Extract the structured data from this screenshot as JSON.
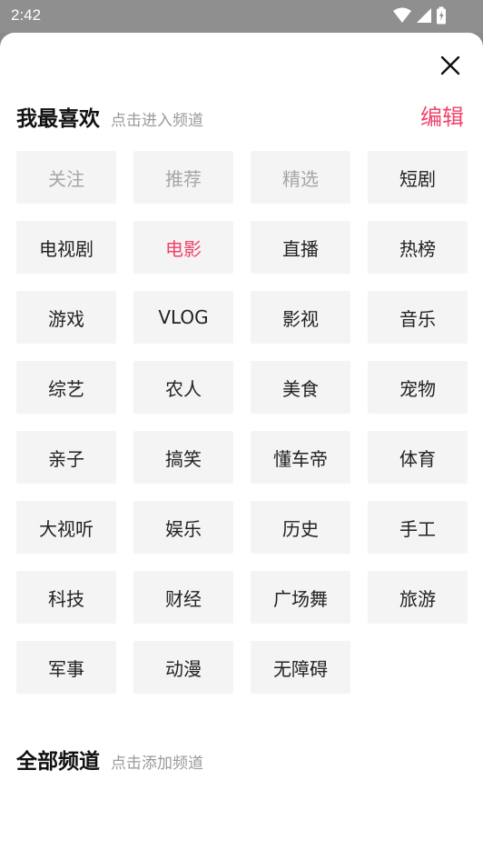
{
  "status_bar": {
    "time": "2:42",
    "icons": [
      "wifi-icon",
      "signal-icon",
      "battery-icon"
    ]
  },
  "favorites": {
    "title": "我最喜欢",
    "hint": "点击进入频道",
    "edit_label": "编辑",
    "channels": [
      {
        "label": "关注",
        "state": "disabled"
      },
      {
        "label": "推荐",
        "state": "disabled"
      },
      {
        "label": "精选",
        "state": "disabled"
      },
      {
        "label": "短剧",
        "state": "normal"
      },
      {
        "label": "电视剧",
        "state": "normal"
      },
      {
        "label": "电影",
        "state": "active"
      },
      {
        "label": "直播",
        "state": "normal"
      },
      {
        "label": "热榜",
        "state": "normal"
      },
      {
        "label": "游戏",
        "state": "normal"
      },
      {
        "label": "VLOG",
        "state": "normal"
      },
      {
        "label": "影视",
        "state": "normal"
      },
      {
        "label": "音乐",
        "state": "normal"
      },
      {
        "label": "综艺",
        "state": "normal"
      },
      {
        "label": "农人",
        "state": "normal"
      },
      {
        "label": "美食",
        "state": "normal"
      },
      {
        "label": "宠物",
        "state": "normal"
      },
      {
        "label": "亲子",
        "state": "normal"
      },
      {
        "label": "搞笑",
        "state": "normal"
      },
      {
        "label": "懂车帝",
        "state": "normal"
      },
      {
        "label": "体育",
        "state": "normal"
      },
      {
        "label": "大视听",
        "state": "normal"
      },
      {
        "label": "娱乐",
        "state": "normal"
      },
      {
        "label": "历史",
        "state": "normal"
      },
      {
        "label": "手工",
        "state": "normal"
      },
      {
        "label": "科技",
        "state": "normal"
      },
      {
        "label": "财经",
        "state": "normal"
      },
      {
        "label": "广场舞",
        "state": "normal"
      },
      {
        "label": "旅游",
        "state": "normal"
      },
      {
        "label": "军事",
        "state": "normal"
      },
      {
        "label": "动漫",
        "state": "normal"
      },
      {
        "label": "无障碍",
        "state": "normal"
      }
    ]
  },
  "all_channels": {
    "title": "全部频道",
    "hint": "点击添加频道"
  },
  "colors": {
    "accent": "#f1436b",
    "chip_bg": "#f4f4f4",
    "disabled_text": "#a6a6a6"
  }
}
